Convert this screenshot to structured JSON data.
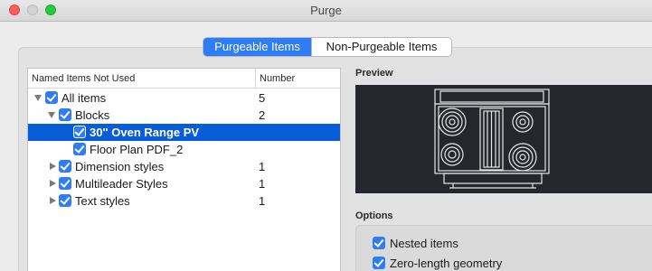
{
  "window": {
    "title": "Purge"
  },
  "tabs": [
    {
      "label": "Purgeable Items",
      "active": true
    },
    {
      "label": "Non-Purgeable Items",
      "active": false
    }
  ],
  "tree": {
    "columns": {
      "name": "Named Items Not Used",
      "number": "Number"
    },
    "rows": [
      {
        "label": "All items",
        "number": "5",
        "level": 0,
        "expanded": true,
        "checked": true,
        "selected": false
      },
      {
        "label": "Blocks",
        "number": "2",
        "level": 1,
        "expanded": true,
        "checked": true,
        "selected": false
      },
      {
        "label": "30'' Oven Range PV",
        "number": "",
        "level": 2,
        "checked": true,
        "selected": true
      },
      {
        "label": "Floor Plan PDF_2",
        "number": "",
        "level": 2,
        "checked": true,
        "selected": false
      },
      {
        "label": "Dimension styles",
        "number": "1",
        "level": 1,
        "expanded": false,
        "checked": true,
        "selected": false
      },
      {
        "label": "Multileader Styles",
        "number": "1",
        "level": 1,
        "expanded": false,
        "checked": true,
        "selected": false
      },
      {
        "label": "Text styles",
        "number": "1",
        "level": 1,
        "expanded": false,
        "checked": true,
        "selected": false
      }
    ]
  },
  "preview": {
    "label": "Preview",
    "background": "#24282e"
  },
  "options": {
    "label": "Options",
    "items": [
      {
        "label": "Nested items",
        "checked": true
      },
      {
        "label": "Zero-length geometry",
        "checked": true
      }
    ]
  },
  "colors": {
    "accent": "#2e7cf6",
    "selection": "#0a5dd8"
  }
}
